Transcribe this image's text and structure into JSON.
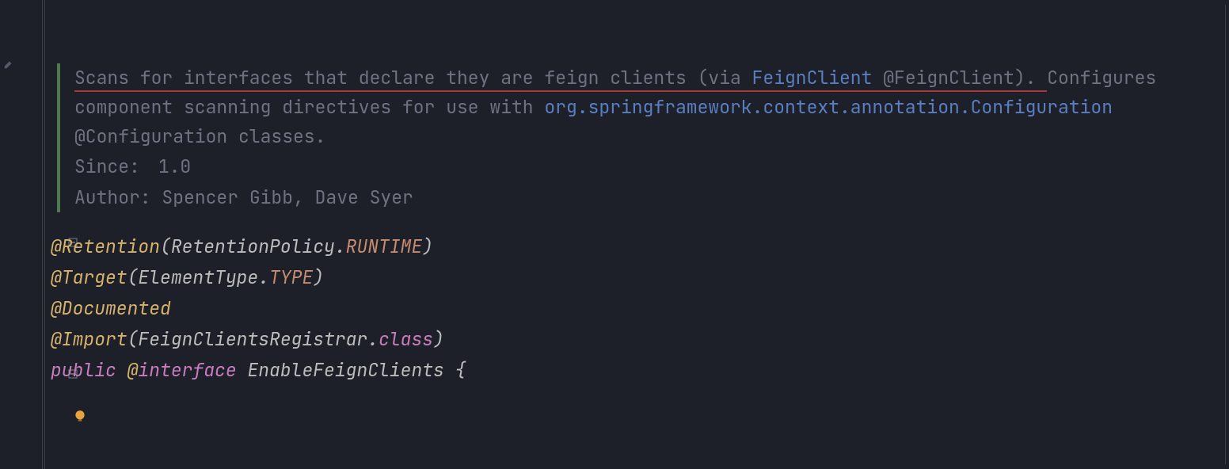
{
  "doc": {
    "desc_pre": "Scans for interfaces that declare they are feign clients (via ",
    "link1": "FeignClient",
    "desc_mid": " @FeignClient). ",
    "desc_after": "Configures component scanning directives for use with ",
    "link2": "org.springframework.context.annotation.Configuration",
    "desc_end": " @Configuration classes.",
    "since_label": "Since:",
    "since_value": "1.0",
    "author_label": "Author:",
    "author_value": "Spencer Gibb, Dave Syer"
  },
  "code": {
    "retention_ann": "@Retention",
    "retention_arg": "RetentionPolicy",
    "retention_const": "RUNTIME",
    "target_ann": "@Target",
    "target_arg": "ElementType",
    "target_const": "TYPE",
    "documented_ann": "@Documented",
    "import_ann": "@Import",
    "import_arg": "FeignClientsRegistrar",
    "class_kw": "class",
    "public_kw": "public ",
    "at": "@",
    "interface_kw": "interface ",
    "typename": "EnableFeignClients",
    "brace": " {"
  }
}
